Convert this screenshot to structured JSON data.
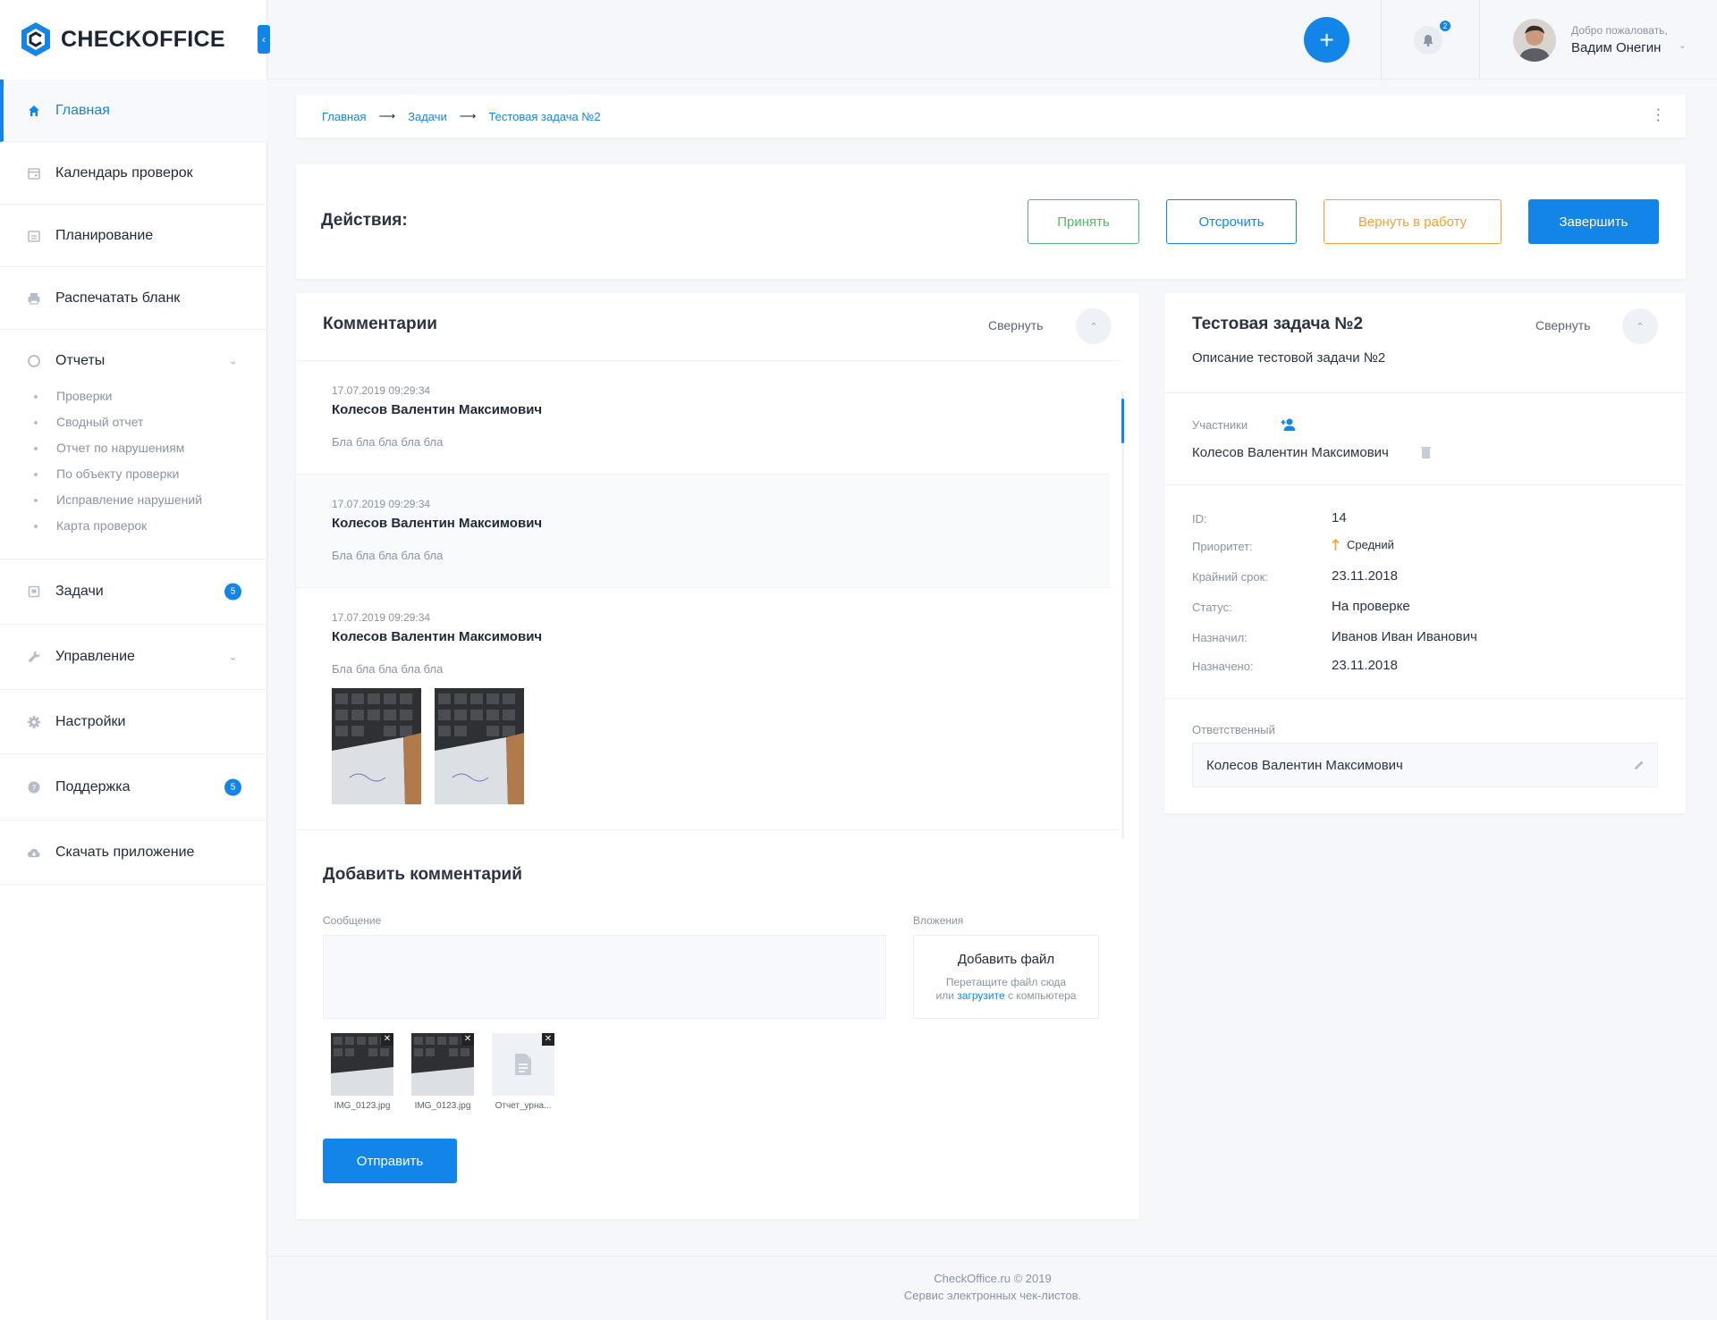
{
  "app": {
    "logo_text": "CHECKOFFICE"
  },
  "sidebar": {
    "collapse_icon": "chevron-left",
    "items": [
      {
        "label": "Главная",
        "icon": "home-icon",
        "active": true
      },
      {
        "label": "Календарь проверок",
        "icon": "calendar-icon"
      },
      {
        "label": "Планирование",
        "icon": "planner-icon"
      },
      {
        "label": "Распечатать бланк",
        "icon": "printer-icon"
      }
    ],
    "reports": {
      "label": "Отчеты",
      "icon": "chart-icon",
      "sub": [
        "Проверки",
        "Сводный отчет",
        "Отчет по нарушениям",
        "По объекту проверки",
        "Исправление нарушений",
        "Карта проверок"
      ]
    },
    "items2": [
      {
        "label": "Задачи",
        "icon": "tasks-icon",
        "badge": "5"
      },
      {
        "label": "Управление",
        "icon": "wrench-icon"
      },
      {
        "label": "Настройки",
        "icon": "gear-icon"
      },
      {
        "label": "Поддержка",
        "icon": "help-icon",
        "badge": "5"
      },
      {
        "label": "Скачать приложение",
        "icon": "cloud-download-icon"
      }
    ]
  },
  "header": {
    "add_icon": "plus",
    "notifications_count": "2",
    "welcome": "Добро пожаловать,",
    "user_name": "Вадим Онегин"
  },
  "breadcrumb": [
    "Главная",
    "Задачи",
    "Тестовая задача №2"
  ],
  "actions": {
    "title": "Действия:",
    "accept": "Принять",
    "postpone": "Отсрочить",
    "return": "Вернуть в работу",
    "finish": "Завершить"
  },
  "comments": {
    "title": "Комментарии",
    "collapse": "Свернуть",
    "items": [
      {
        "date": "17.07.2019 09:29:34",
        "author": "Колесов Валентин Максимович",
        "text": "Бла бла бла бла бла"
      },
      {
        "date": "17.07.2019 09:29:34",
        "author": "Колесов Валентин Максимович",
        "text": "Бла бла бла бла бла"
      },
      {
        "date": "17.07.2019 09:29:34",
        "author": "Колесов Валентин Максимович",
        "text": "Бла бла бла бла бла"
      }
    ]
  },
  "add_comment": {
    "title": "Добавить комментарий",
    "message_label": "Сообщение",
    "attachments_label": "Вложения",
    "add_file": "Добавить файл",
    "drop_hint_1": "Перетащите файл сюда",
    "drop_hint_or": "или",
    "drop_hint_link": "загрузите",
    "drop_hint_2": "с компьютера",
    "files": [
      "IMG_0123.jpg",
      "IMG_0123.jpg",
      "Отчет_урна..."
    ],
    "send": "Отправить"
  },
  "task": {
    "title": "Тестовая задача №2",
    "collapse": "Свернуть",
    "description": "Описание тестовой задачи №2",
    "participants_label": "Участники",
    "participant": "Колесов Валентин Максимович",
    "fields": {
      "id_label": "ID:",
      "id": "14",
      "priority_label": "Приоритет:",
      "priority": "Средний",
      "deadline_label": "Крайний срок:",
      "deadline": "23.11.2018",
      "status_label": "Статус:",
      "status": "На проверке",
      "assigner_label": "Назначил:",
      "assigner": "Иванов Иван Иванович",
      "assigned_label": "Назначено:",
      "assigned": "23.11.2018"
    },
    "responsible_label": "Ответственный",
    "responsible": "Колесов Валентин Максимович"
  },
  "footer": {
    "line1": "CheckOffice.ru © 2019",
    "line2": "Сервис электронных чек-листов."
  },
  "colors": {
    "accent": "#1485e8",
    "green": "#52b96a",
    "orange": "#f2a13b"
  }
}
